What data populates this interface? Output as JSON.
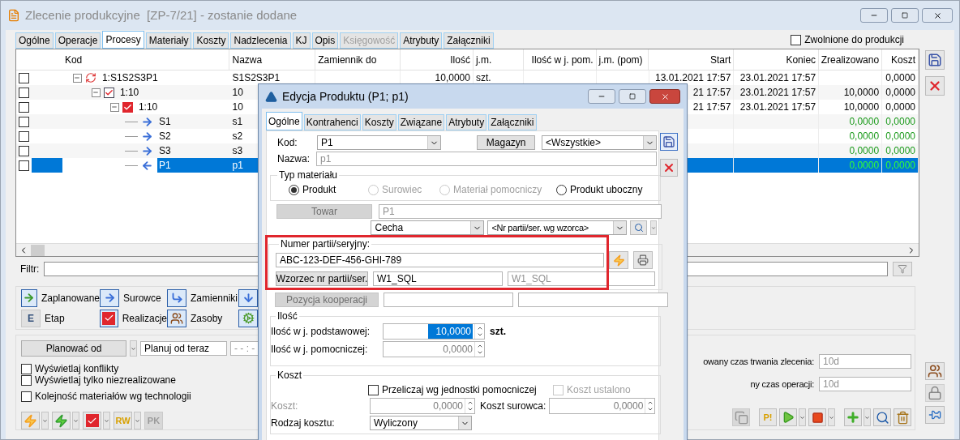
{
  "window": {
    "title": "Zlecenie produkcyjne  [ZP-7/21] - zostanie dodane",
    "active": false
  },
  "tabs": [
    {
      "label": "Ogólne",
      "selected": false,
      "disabled": false
    },
    {
      "label": "Operacje",
      "selected": false,
      "disabled": false
    },
    {
      "label": "Procesy",
      "selected": true,
      "disabled": false
    },
    {
      "label": "Materiały",
      "selected": false,
      "disabled": false
    },
    {
      "label": "Koszty",
      "selected": false,
      "disabled": false
    },
    {
      "label": "Nadzlecenia",
      "selected": false,
      "disabled": false
    },
    {
      "label": "KJ",
      "selected": false,
      "disabled": false
    },
    {
      "label": "Opis",
      "selected": false,
      "disabled": false
    },
    {
      "label": "Księgowość",
      "selected": false,
      "disabled": true
    },
    {
      "label": "Atrybuty",
      "selected": false,
      "disabled": false
    },
    {
      "label": "Załączniki",
      "selected": false,
      "disabled": false
    }
  ],
  "released": {
    "label": "Zwolnione do produkcji",
    "checked": false
  },
  "table": {
    "columns": [
      "Kod",
      "Nazwa",
      "Zamiennik do",
      "Ilość",
      "j.m.",
      "Ilość w j. pom.",
      "j.m. (pom)",
      "Start",
      "Koniec",
      "Zrealizowano",
      "Koszt"
    ],
    "rows": [
      {
        "kind": "process",
        "code": "1:S1S2S3P1",
        "checked": false,
        "selected": false,
        "expanded": true,
        "cells": {
          "nazwa": "S1S2S3P1",
          "ilosc": "10,0000",
          "jm": "szt.",
          "start": "13.01.2021 17:57",
          "koniec": "23.01.2021 17:57",
          "koszt": "0,0000"
        },
        "children": [
          {
            "kind": "operation",
            "code": "1:10",
            "checked": false,
            "selected": false,
            "expanded": true,
            "cells": {
              "nazwa": "10",
              "start": "21 17:57",
              "koniec": "23.01.2021 17:57",
              "zrealizowano": "10,0000",
              "koszt": "0,0000"
            },
            "children": [
              {
                "kind": "realization",
                "code": "1:10",
                "checked": false,
                "selected": false,
                "expanded": true,
                "cells": {
                  "nazwa": "10",
                  "start": "21 17:57",
                  "koniec": "23.01.2021 17:57",
                  "zrealizowano": "10,0000",
                  "koszt": "0,0000"
                },
                "children": [
                  {
                    "kind": "input",
                    "code": "S1",
                    "checked": false,
                    "selected": false,
                    "cells": {
                      "nazwa": "s1",
                      "zrealizowano": "0,0000",
                      "koszt": "0,0000"
                    }
                  },
                  {
                    "kind": "input",
                    "code": "S2",
                    "checked": false,
                    "selected": false,
                    "cells": {
                      "nazwa": "s2",
                      "zrealizowano": "0,0000",
                      "koszt": "0,0000"
                    }
                  },
                  {
                    "kind": "input",
                    "code": "S3",
                    "checked": false,
                    "selected": false,
                    "cells": {
                      "nazwa": "s3",
                      "zrealizowano": "0,0000",
                      "koszt": "0,0000"
                    }
                  },
                  {
                    "kind": "output",
                    "code": "P1",
                    "checked": false,
                    "selected": true,
                    "cells": {
                      "nazwa": "p1",
                      "zrealizowano": "0,0000",
                      "koszt": "0,0000"
                    }
                  }
                ]
              }
            ]
          }
        ]
      }
    ]
  },
  "filter": {
    "label": "Filtr:"
  },
  "legend": [
    {
      "kind": "planned",
      "label": "Zaplanowane"
    },
    {
      "kind": "input",
      "label": "Surowce"
    },
    {
      "kind": "substitute",
      "label": "Zamienniki"
    },
    {
      "kind": "down"
    },
    {
      "kind": "stage",
      "glyph": "E",
      "label": "Etap"
    },
    {
      "kind": "realization",
      "label": "Realizacje"
    },
    {
      "kind": "resources",
      "label": "Zasoby"
    },
    {
      "kind": "gear"
    }
  ],
  "planning": {
    "button": "Planować od",
    "mode": "Planuj od teraz",
    "time": "- - : -"
  },
  "options": [
    {
      "label": "Wyświetlaj konflikty",
      "checked": false
    },
    {
      "label": "Wyświetlaj tylko niezrealizowane",
      "checked": false
    },
    {
      "label": "Kolejność materiałów wg technologii",
      "checked": false
    }
  ],
  "left_toolbar": [
    {
      "kind": "zap_orange",
      "dropdown": true,
      "disabled": false
    },
    {
      "kind": "zap_green",
      "dropdown": true,
      "disabled": false
    },
    {
      "kind": "realization",
      "dropdown": true,
      "disabled": false
    },
    {
      "kind": "glyph",
      "glyph": "RW",
      "dropdown": true,
      "disabled": false
    },
    {
      "kind": "glyph",
      "glyph": "PK",
      "dropdown": false,
      "disabled": true
    }
  ],
  "durations": [
    {
      "label": "owany czas trwania zlecenia:",
      "value": "10d"
    },
    {
      "label": "ny czas operacji:",
      "value": "10d"
    }
  ],
  "right_toolbar": [
    {
      "kind": "copy",
      "dropdown": false,
      "disabled": true
    },
    {
      "kind": "glyph",
      "glyph": "P!",
      "dropdown": false,
      "disabled": false
    },
    {
      "kind": "play",
      "dropdown": true,
      "disabled": false
    },
    {
      "kind": "stop",
      "dropdown": true,
      "disabled": false
    },
    {
      "kind": "add",
      "dropdown": true,
      "disabled": false
    },
    {
      "kind": "search",
      "dropdown": false,
      "disabled": false
    },
    {
      "kind": "delete",
      "dropdown": false,
      "disabled": false
    }
  ],
  "side_top": [
    {
      "kind": "save",
      "disabled": false
    },
    {
      "kind": "cancel",
      "disabled": false
    }
  ],
  "side_bottom": [
    {
      "kind": "resources",
      "disabled": false
    },
    {
      "kind": "lock",
      "disabled": true
    },
    {
      "kind": "pin",
      "disabled": false
    }
  ],
  "dialog": {
    "title": "Edycja Produktu (P1; p1)",
    "tabs": [
      {
        "label": "Ogólne",
        "selected": true
      },
      {
        "label": "Kontrahenci",
        "selected": false
      },
      {
        "label": "Koszty",
        "selected": false
      },
      {
        "label": "Związane",
        "selected": false
      },
      {
        "label": "Atrybuty",
        "selected": false
      },
      {
        "label": "Załączniki",
        "selected": false
      }
    ],
    "kod": {
      "label": "Kod:",
      "value": "P1"
    },
    "magazyn": {
      "button": "Magazyn",
      "value": "<Wszystkie>"
    },
    "nazwa": {
      "label": "Nazwa:",
      "value": "p1"
    },
    "material_type": {
      "title": "Typ materiału",
      "options": [
        {
          "label": "Produkt",
          "selected": true,
          "disabled": false
        },
        {
          "label": "Surowiec",
          "selected": false,
          "disabled": true
        },
        {
          "label": "Materiał pomocniczy",
          "selected": false,
          "disabled": true
        },
        {
          "label": "Produkt uboczny",
          "selected": false,
          "disabled": false
        }
      ]
    },
    "towar": {
      "button": "Towar",
      "disabled": true,
      "value": "P1"
    },
    "cecha": {
      "value": "Cecha"
    },
    "pattern_select": {
      "value": "<Nr partii/ser. wg wzorca>"
    },
    "serial": {
      "title": "Numer partii/seryjny:",
      "value": "ABC-123-DEF-456-GHI-789",
      "highlighted": true
    },
    "pattern": {
      "button": "Wzorzec nr partii/ser.",
      "value": "W1_SQL",
      "value_2": "W1_SQL"
    },
    "cooperation": {
      "button": "Pozycja kooperacji",
      "disabled": true
    },
    "quantity": {
      "title": "Ilość",
      "base_label": "Ilość w j. podstawowej:",
      "base_value": "10,0000",
      "unit": "szt.",
      "aux_label": "Ilość w j. pomocniczej:",
      "aux_value": "0,0000"
    },
    "cost": {
      "title": "Koszt",
      "recalc": {
        "label": "Przeliczaj wg jednostki pomocniczej",
        "checked": false,
        "disabled": false
      },
      "fixed": {
        "label": "Koszt ustalono",
        "checked": false,
        "disabled": true
      },
      "cost_label": "Koszt:",
      "cost_value": "0,0000",
      "material_cost_label": "Koszt surowca:",
      "material_cost_value": "0,0000",
      "type_label": "Rodzaj kosztu:",
      "type_value": "Wyliczony"
    }
  }
}
